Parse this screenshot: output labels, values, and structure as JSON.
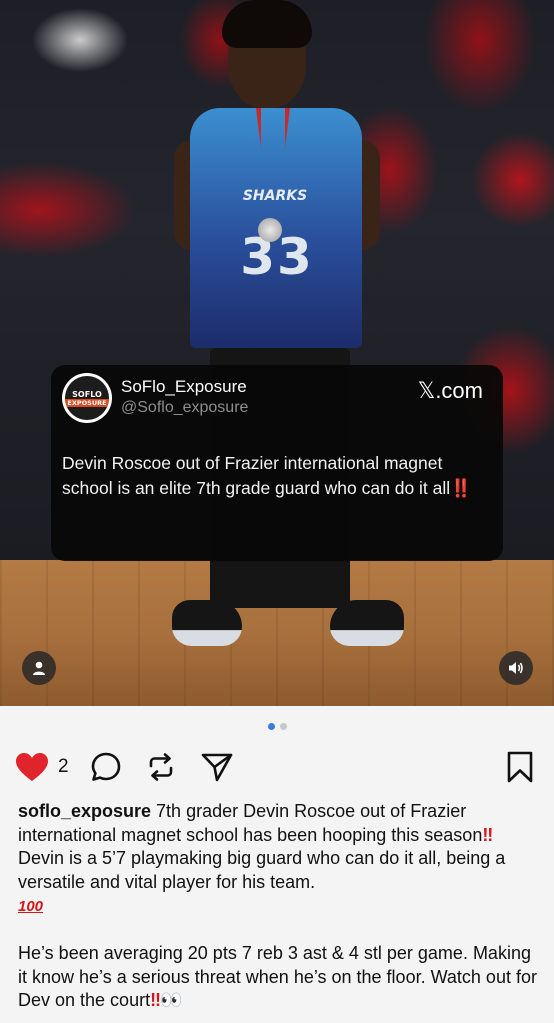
{
  "post": {
    "media": {
      "jersey_number": "33",
      "jersey_team": "SHARKS",
      "backdrop_colors": [
        "#1e1f26",
        "#a0141c"
      ],
      "carousel_total": 2,
      "carousel_active": 1
    },
    "tweet_card": {
      "avatar_line1": "SOFLO",
      "avatar_line2": "EXPOSURE",
      "name": "SoFlo_Exposure",
      "handle": "@Soflo_exposure",
      "brand": "𝕏.com",
      "text": "Devin Roscoe out of Frazier international magnet school is an elite 7th grade guard who can do it all",
      "text_emoji": "‼️"
    },
    "actions": {
      "like_count": "2",
      "like_color": "#e0242b"
    },
    "caption": {
      "username": "soflo_exposure",
      "p1_a": " 7th grader Devin Roscoe out of Frazier international magnet school has been hooping this season",
      "p1_bang1": "‼",
      "p1_b": " Devin is a 5’7 playmaking big guard who can do it all, being a versatile and vital player for his team.",
      "p1_hundred": "100",
      "p2_a": "He’s been averaging 20 pts 7 reb 3 ast & 4 stl per game. Making it know he’s a serious threat when he’s  on the floor. Watch out for Dev on the court",
      "p2_bang": "‼",
      "p2_eyes": "👀"
    }
  }
}
